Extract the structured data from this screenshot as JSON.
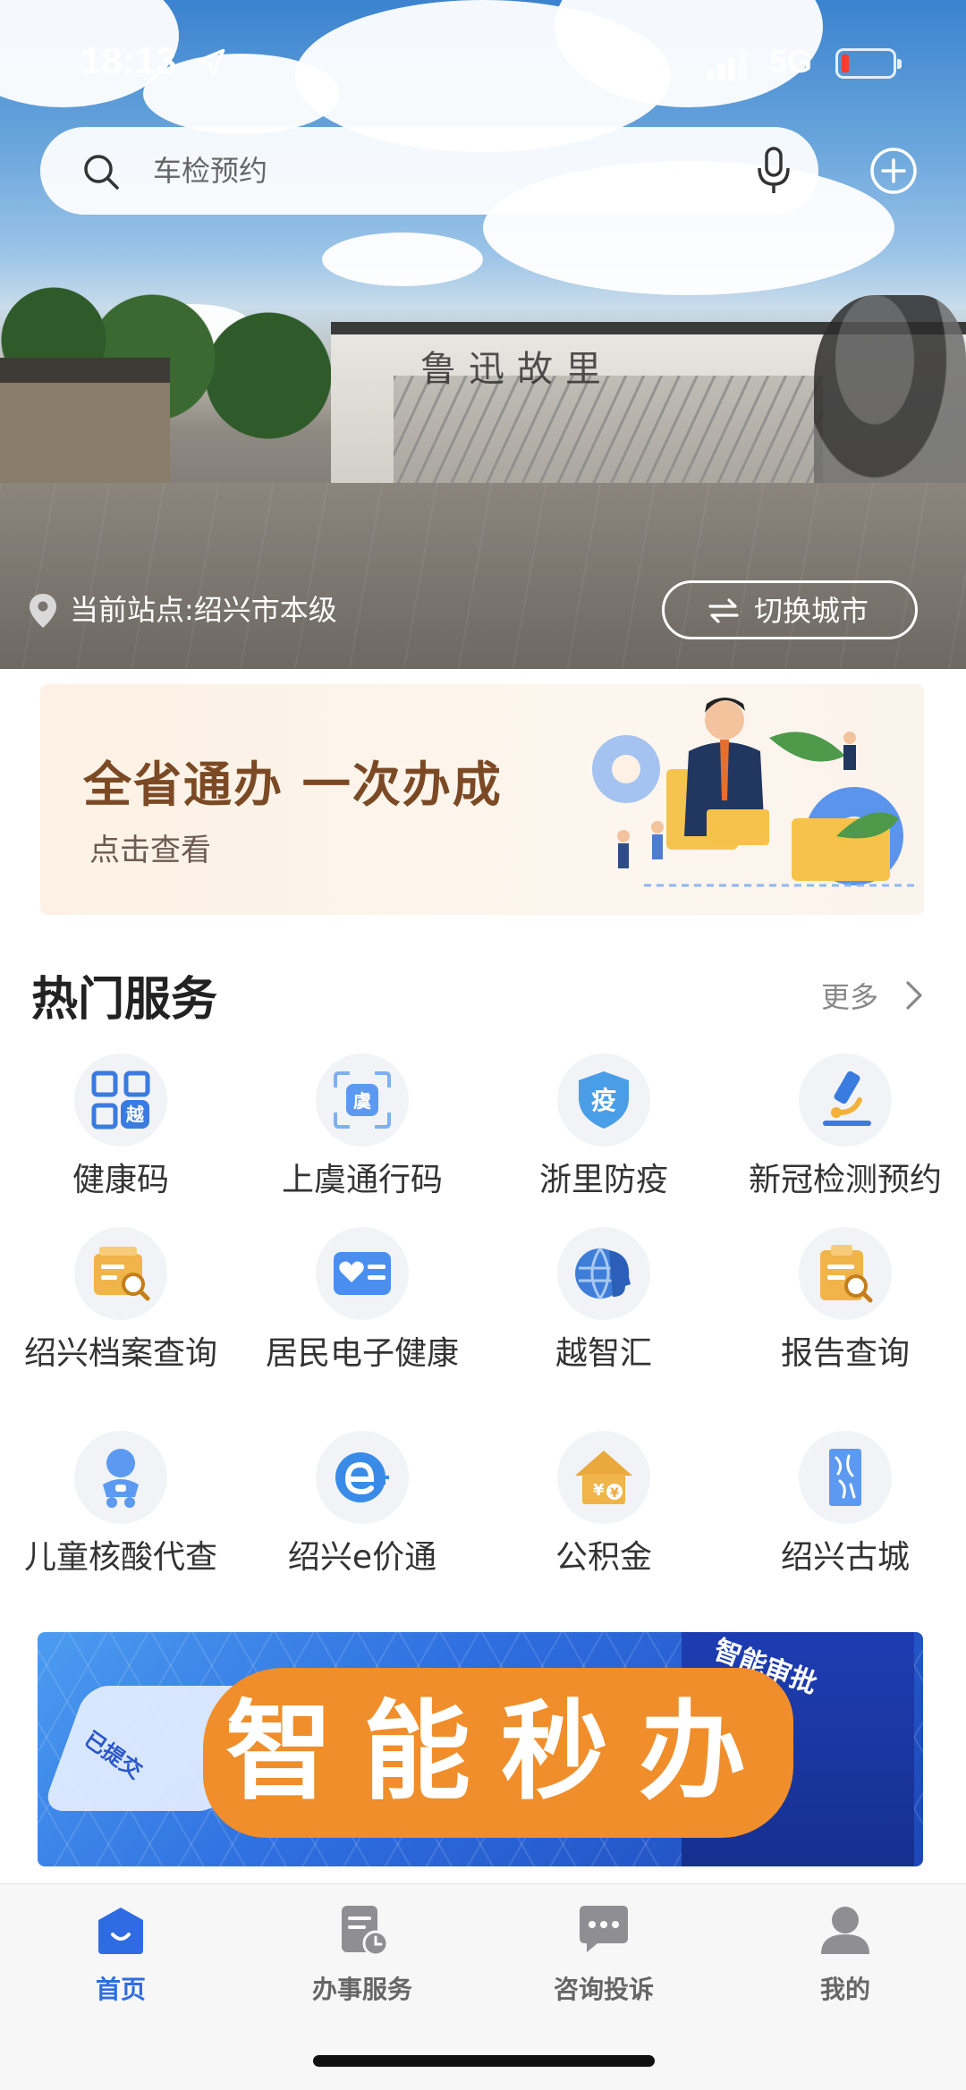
{
  "status_bar": {
    "time": "18:13",
    "network": "5G"
  },
  "search": {
    "placeholder": "车检预约"
  },
  "hero": {
    "location_text": "当前站点:绍兴市本级",
    "switch_city_label": "切换城市",
    "wall_title": "鲁迅故里"
  },
  "promo": {
    "title": "全省通办  一次办成",
    "subtitle": "点击查看"
  },
  "hot_services": {
    "title": "热门服务",
    "more_label": "更多",
    "items": [
      {
        "label": "健康码",
        "icon": "health-code-icon"
      },
      {
        "label": "上虞通行码",
        "icon": "pass-code-icon"
      },
      {
        "label": "浙里防疫",
        "icon": "epidemic-shield-icon"
      },
      {
        "label": "新冠检测预约",
        "icon": "microscope-icon"
      },
      {
        "label": "绍兴档案查询",
        "icon": "archive-search-icon"
      },
      {
        "label": "居民电子健康",
        "icon": "health-card-icon"
      },
      {
        "label": "越智汇",
        "icon": "globe-head-icon"
      },
      {
        "label": "报告查询",
        "icon": "report-search-icon"
      },
      {
        "label": "儿童核酸代查",
        "icon": "child-icon"
      },
      {
        "label": "绍兴e价通",
        "icon": "e-price-icon"
      },
      {
        "label": "公积金",
        "icon": "housing-fund-icon"
      },
      {
        "label": "绍兴古城",
        "icon": "ancient-city-icon"
      }
    ]
  },
  "banner": {
    "text": "智能秒办",
    "tag_left": "已提交",
    "tag_right": "智能审批"
  },
  "tabbar": {
    "items": [
      {
        "label": "首页",
        "icon": "home-icon",
        "active": true
      },
      {
        "label": "办事服务",
        "icon": "service-doc-icon",
        "active": false
      },
      {
        "label": "咨询投诉",
        "icon": "chat-icon",
        "active": false
      },
      {
        "label": "我的",
        "icon": "profile-icon",
        "active": false
      }
    ]
  },
  "colors": {
    "accent": "#2f6ce3",
    "promo_title": "#7b4a25",
    "banner_orange": "#ef8e2b"
  }
}
